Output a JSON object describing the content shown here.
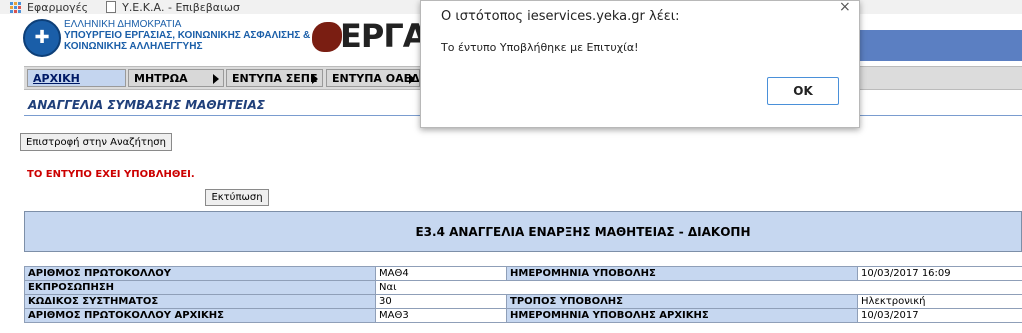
{
  "bookmarks": {
    "apps_label": "Εφαρμογές",
    "page_label": "Υ.Ε.Κ.Α. - Επιβεβαιωσ"
  },
  "header": {
    "ministry_line1": "ΕΛΛΗΝΙΚΗ ΔΗΜΟΚΡΑΤΙΑ",
    "ministry_line2": "ΥΠΟΥΡΓΕΙΟ ΕΡΓΑΣΙΑΣ, ΚΟΙΝΩΝΙΚΗΣ ΑΣΦΑΛΙΣΗΣ &",
    "ministry_line3": "ΚΟΙΝΩΝΙΚΗΣ ΑΛΛΗΛΕΓΓΥΗΣ",
    "logo_text": "ΕΡΓΑΝΗ",
    "bar_color": "#5b7fc2"
  },
  "nav": {
    "items": [
      {
        "label": "ΑΡΧΙΚΗ"
      },
      {
        "label": "ΜΗΤΡΩΑ"
      },
      {
        "label": "ΕΝΤΥΠΑ ΣΕΠΕ"
      },
      {
        "label": "ΕΝΤΥΠΑ ΟΑΕΔ"
      }
    ]
  },
  "page": {
    "title": "ΑΝΑΓΓΕΛΙΑ ΣΥΜΒΑΣΗΣ ΜΑΘΗΤΕΙΑΣ",
    "back_button": "Επιστροφή στην Αναζήτηση",
    "status_message": "ΤΟ ΕΝΤΥΠΟ ΕΧΕΙ ΥΠΟΒΛΗΘΕΙ.",
    "print_button": "Εκτύπωση",
    "form_title": "Ε3.4 ΑΝΑΓΓΕΛΙΑ ΕΝΑΡΞΗΣ ΜΑΘΗΤΕΙΑΣ - ΔΙΑΚΟΠΗ"
  },
  "table": {
    "rows": [
      {
        "l1": "ΑΡΙΘΜΟΣ ΠΡΩΤΟΚΟΛΛΟΥ",
        "v1": "ΜΑΘ4",
        "l2": "ΗΜΕΡΟΜΗΝΙΑ ΥΠΟΒΟΛΗΣ",
        "v2": "10/03/2017 16:09"
      },
      {
        "l1": "ΕΚΠΡΟΣΩΠΗΣΗ",
        "v1": "Ναι"
      },
      {
        "l1": "ΚΩΔΙΚΟΣ ΣΥΣΤΗΜΑΤΟΣ",
        "v1": "30",
        "l2": "ΤΡΟΠΟΣ ΥΠΟΒΟΛΗΣ",
        "v2": "Ηλεκτρονική"
      },
      {
        "l1": "ΑΡΙΘΜΟΣ ΠΡΩΤΟΚΟΛΛΟΥ ΑΡΧΙΚΗΣ",
        "v1": "ΜΑΘ3",
        "l2": "ΗΜΕΡΟΜΗΝΙΑ ΥΠΟΒΟΛΗΣ ΑΡΧΙΚΗΣ",
        "v2": "10/03/2017"
      }
    ]
  },
  "dialog": {
    "title": "Ο ιστότοπος ieservices.yeka.gr λέει:",
    "message": "Το έντυπο Υποβλήθηκε με Επιτυχία!",
    "ok_label": "OK",
    "close_glyph": "×"
  }
}
